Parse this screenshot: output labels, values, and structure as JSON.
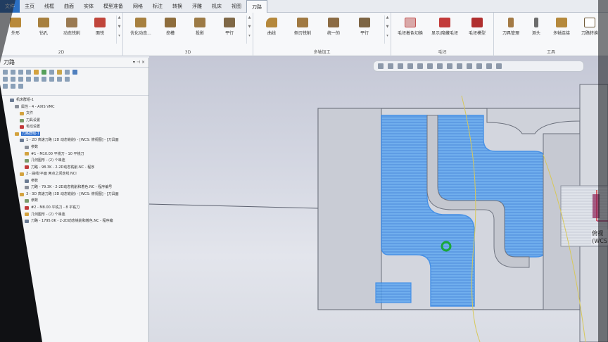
{
  "ribbon": {
    "tabs": [
      "文件",
      "主页",
      "线框",
      "曲面",
      "实体",
      "模型准备",
      "网格",
      "标注",
      "转换",
      "浮雕",
      "机床",
      "视图",
      "刀路"
    ],
    "active_tab": "刀路",
    "groups": [
      {
        "label": "2D",
        "buttons": [
          "外形",
          "钻孔",
          "动态铣削",
          "面铣"
        ]
      },
      {
        "label": "3D",
        "buttons": [
          "优化动态...",
          "挖槽",
          "投影",
          "平行"
        ]
      },
      {
        "label": "多轴加工",
        "buttons": [
          "曲线",
          "侧刃铣削",
          "统一的",
          "平行"
        ]
      },
      {
        "label": "毛坯",
        "buttons": [
          "毛坯着色切换",
          "显示/隐藏毛坯",
          "毛坯模型"
        ]
      },
      {
        "label": "工具",
        "buttons": [
          "刀具管理",
          "测头",
          "多轴连接",
          "刀路转换"
        ]
      }
    ]
  },
  "panel": {
    "title": "刀路",
    "pin": "▾ ⊣ ×",
    "tree": [
      {
        "text": "机床群组-1",
        "level": 0
      },
      {
        "text": "属性 - 4 - AXIS VMC",
        "level": 1
      },
      {
        "text": "文件",
        "level": 2
      },
      {
        "text": "刀具设置",
        "level": 2
      },
      {
        "text": "毛坯设置",
        "level": 2
      },
      {
        "text": "刀路群组-1",
        "level": 1,
        "selected": true
      },
      {
        "text": "1 - 2D 高速刀路 (2D 动态铣削) - [WCS: 俯视图] - [刀具面",
        "level": 2
      },
      {
        "text": "参数",
        "level": 3
      },
      {
        "text": "#1 - M10.00 平铣刀 - 10 平铣刀",
        "level": 3
      },
      {
        "text": "几何图形 - (2) 个串连",
        "level": 3
      },
      {
        "text": "刀路 - 98.3K - 2-2D动态铣削.NC - 程序",
        "level": 3
      },
      {
        "text": "2 - 曲线/平面 两点之间走线 NCI",
        "level": 2
      },
      {
        "text": "参数",
        "level": 3
      },
      {
        "text": "刀路 - 79.3K - 2-2D动态铣削和着色.NC - 程序编号",
        "level": 3
      },
      {
        "text": "3 - 3D 高速刀路 (3D 动态铣削) - [WCS: 俯视图] - [刀具面",
        "level": 2
      },
      {
        "text": "参数",
        "level": 3
      },
      {
        "text": "#2 - M8.00 平铣刀 - 8 平铣刀",
        "level": 3
      },
      {
        "text": "几何图形 - (2) 个串连",
        "level": 3
      },
      {
        "text": "刀路 - 1795.0K - 2-2D动态铣削和着色.NC - 程序编",
        "level": 3
      }
    ]
  },
  "viewport": {
    "view_label_1": "俯视",
    "view_label_2": "(WCS"
  },
  "colors": {
    "toolpath": "#2f86e8",
    "part": "#cfd2da",
    "accent": "#2b6fc2"
  }
}
